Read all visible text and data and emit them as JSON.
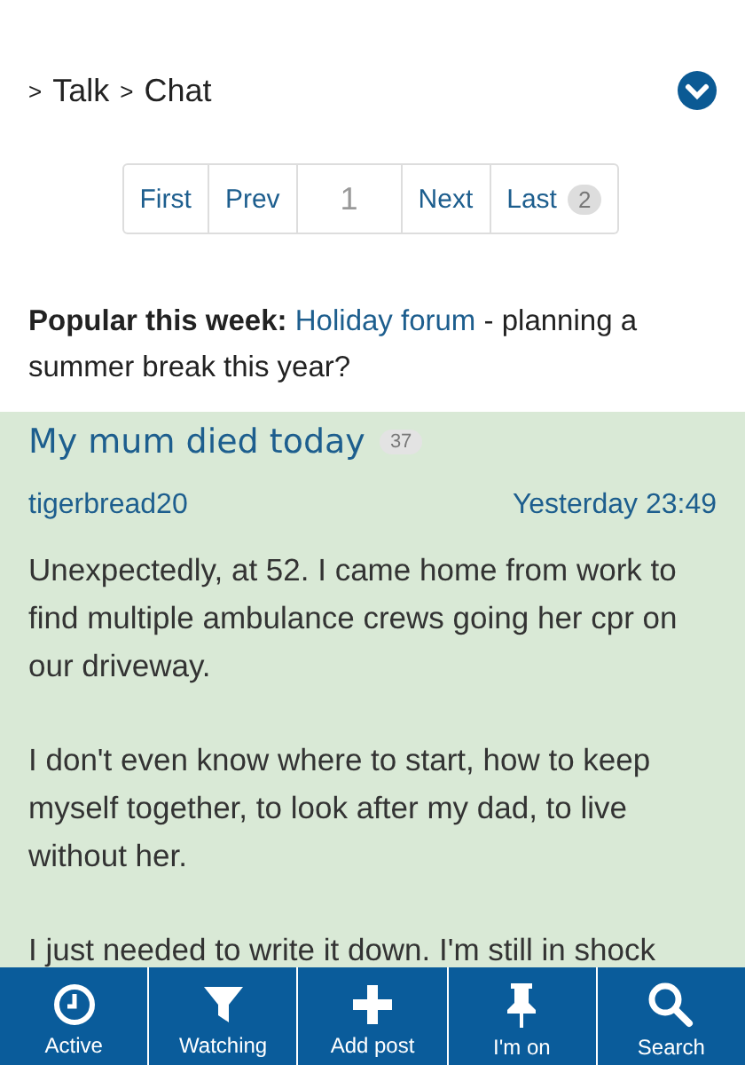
{
  "breadcrumb": [
    ">",
    "Talk",
    ">",
    "Chat"
  ],
  "pager": {
    "first": "First",
    "prev": "Prev",
    "current": "1",
    "next": "Next",
    "last": "Last",
    "last_count": "2"
  },
  "popular": {
    "label": "Popular this week:",
    "link": "Holiday forum",
    "text": "- planning a summer break this year?"
  },
  "thread": {
    "title": "My mum died today",
    "replies": "37",
    "author": "tigerbread20",
    "time": "Yesterday 23:49",
    "paragraphs": [
      "Unexpectedly, at 52. I came home from work to find multiple ambulance crews going her cpr on our driveway.",
      "I don't even know where to start, how to keep myself together, to look after my dad, to live without her.",
      "I just needed to write it down. I'm still in shock"
    ]
  },
  "nav": [
    {
      "label": "Active"
    },
    {
      "label": "Watching"
    },
    {
      "label": "Add post"
    },
    {
      "label": "I'm on"
    },
    {
      "label": "Search"
    }
  ]
}
